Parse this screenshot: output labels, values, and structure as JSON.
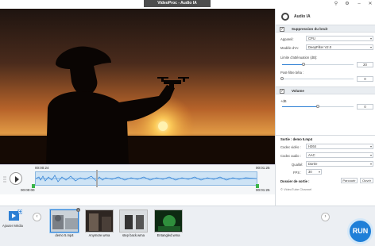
{
  "window": {
    "title": "VideoProc - Audio IA",
    "buttons": {
      "pin": "⚲",
      "settings": "⚙",
      "minimize": "–",
      "close": "✕"
    }
  },
  "timeline": {
    "current_time": "00:00:24",
    "end_time": "00:01:25",
    "start_time": "00:00:00",
    "end_time_bottom": "00:01:25"
  },
  "panel": {
    "title": "Audio IA",
    "noise_section": {
      "label": "Suppression du bruit",
      "checked": true,
      "device_label": "Appareil:",
      "device_value": "CPU",
      "model_label": "Modèle d'IA:",
      "model_value": "DeepFilter V2.0",
      "limit_label": "Limite d'atténuation (dB):",
      "limit_value": "20",
      "limit_level": 0.3,
      "postfilter_label": "Post-filtre bêta :",
      "postfilter_value": "0",
      "postfilter_level": 0.0
    },
    "volume_section": {
      "label": "Volume",
      "checked": true,
      "db_label": "+dB",
      "db_value": "0",
      "db_level": 0.5
    },
    "output": {
      "label": "Sortie : demo 5.mp4",
      "video_codec_label": "Codec vidéo :",
      "video_codec_value": "H264",
      "audio_codec_label": "Codec audio :",
      "audio_codec_value": "AAC",
      "quality_label": "Qualité:",
      "quality_value": "Dorée",
      "fps_label": "FPS :",
      "fps_value": "30",
      "folder_label": "Dossier de sortie :",
      "browse_button": "Parcourir",
      "open_button": "Ouvrir",
      "channel_link": "© VideoTube Channel"
    }
  },
  "bottom": {
    "add_media_label": "Ajouter Média",
    "files": [
      {
        "name": "demo 5.mp4",
        "active": true
      },
      {
        "name": "Anymore.wma",
        "active": false
      },
      {
        "name": "step back.wma",
        "active": false
      },
      {
        "name": "Entangled.wma",
        "active": false
      }
    ],
    "run_label": "RUN"
  },
  "colors": {
    "accent": "#1f7fd8",
    "title_bar": "#4d4d4d",
    "waveform": "#2d7fd4",
    "trim_handle": "#3bb54a"
  }
}
